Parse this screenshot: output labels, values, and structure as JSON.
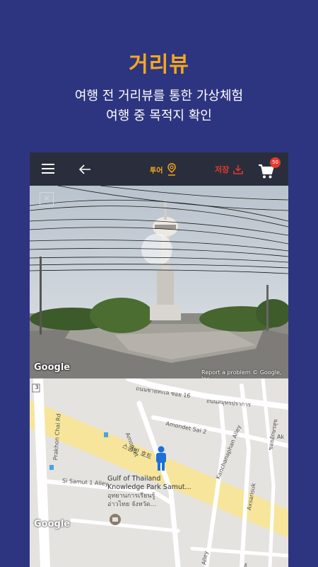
{
  "hero": {
    "title": "거리뷰",
    "line1": "여행 전 거리뷰를 통한 가상체험",
    "line2": "여행 중 목적지 확인"
  },
  "appbar": {
    "tour_label": "투어",
    "save_label": "저장",
    "cart_count": "50"
  },
  "streetview": {
    "close_glyph": "✕",
    "google_label": "Google",
    "report_text": "Report a problem",
    "copyright": "© Google, Inc."
  },
  "map": {
    "google_label": "Google",
    "route_badge": "3",
    "road_thai_1": "ถนนชายทะเล ซอย 16",
    "road_thai_2": "ถนนสมุทรปราการ",
    "road_amondet": "Amondet",
    "road_amondet_sai2": "Amondet Sai 2",
    "road_kanchanaphan": "Kanchanaphan Alley",
    "road_axsarisuk": "Axsarisuk",
    "road_thai_3": "ซอยอักษรสุข",
    "road_prakhon": "Prakhon Chai Rd",
    "road_samut1": "Si Samut 1 Alley",
    "road_suk_ho": "스쿰빗 호트",
    "road_alley": "Alley",
    "road_ak": "Ak",
    "road_ak2": "อั",
    "poi_name_1": "Gulf of Thailand",
    "poi_name_2": "Knowledge Park Samut...",
    "poi_thai_1": "อุทยานการเรียนรู้",
    "poi_thai_2": "อ่าวไทย จังหวัด..."
  },
  "colors": {
    "background": "#2e3580",
    "accent": "#f3a91e",
    "save_red": "#e23a2e",
    "appbar": "#2a2e3c",
    "pegman": "#1e6fd9"
  }
}
